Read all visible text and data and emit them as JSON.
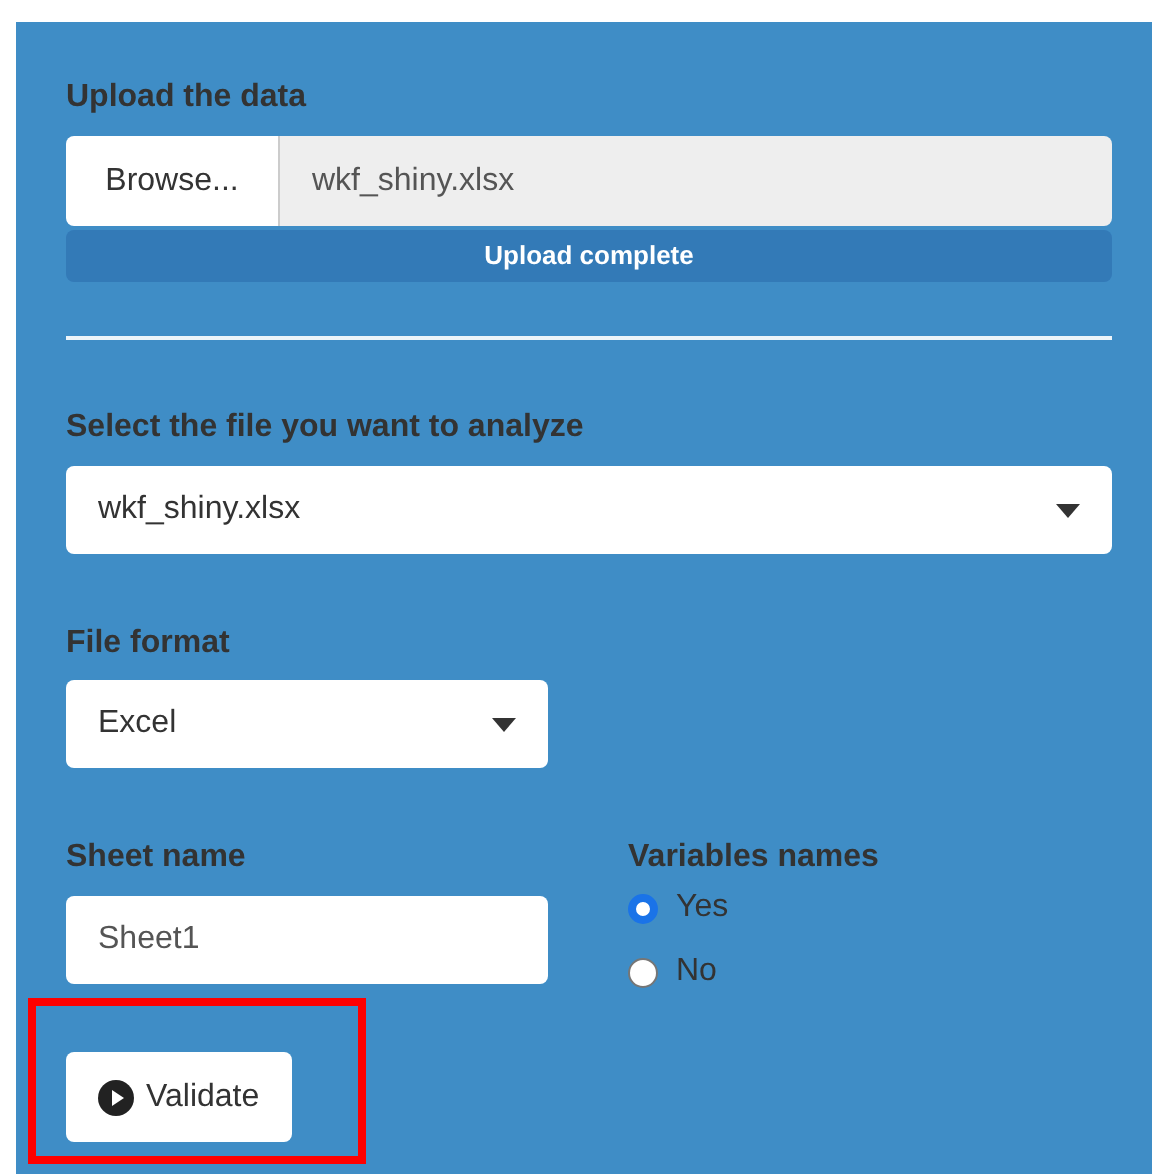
{
  "upload": {
    "label": "Upload the data",
    "button": "Browse...",
    "filename": "wkf_shiny.xlsx",
    "progress": {
      "text": "Upload complete",
      "level": 1
    }
  },
  "file_select": {
    "label": "Select the file you want to analyze",
    "value": "wkf_shiny.xlsx"
  },
  "file_format": {
    "label": "File format",
    "value": "Excel"
  },
  "sheet_name": {
    "label": "Sheet name",
    "value": "Sheet1"
  },
  "variables_names": {
    "label": "Variables names",
    "options": [
      {
        "label": "Yes",
        "selected": true
      },
      {
        "label": "No",
        "selected": false
      }
    ]
  },
  "validate_button": {
    "label": "Validate",
    "highlighted": true
  }
}
